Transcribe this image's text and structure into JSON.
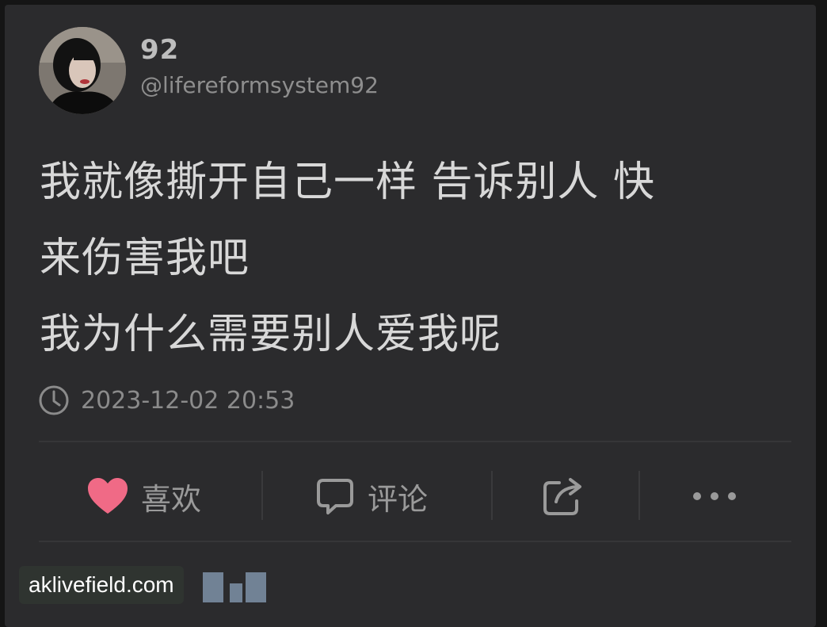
{
  "post": {
    "username": "92",
    "handle": "@lifereformsystem92",
    "text_lines": [
      "我就像撕开自己一样 告诉别人 快",
      "来伤害我吧",
      "我为什么需要别人爱我呢"
    ],
    "timestamp": "2023-12-02 20:53"
  },
  "actions": {
    "like_label": "喜欢",
    "comment_label": "评论",
    "share_icon": "share-icon",
    "more_icon": "more-icon"
  },
  "icons": {
    "clock": "clock-icon",
    "heart": "heart-icon",
    "comment": "comment-icon"
  },
  "colors": {
    "background": "#2b2b2d",
    "text": "#d8d8d8",
    "muted": "#8b8b8b",
    "like": "#f06a86"
  },
  "watermark": {
    "text": "aklivefield.com"
  }
}
